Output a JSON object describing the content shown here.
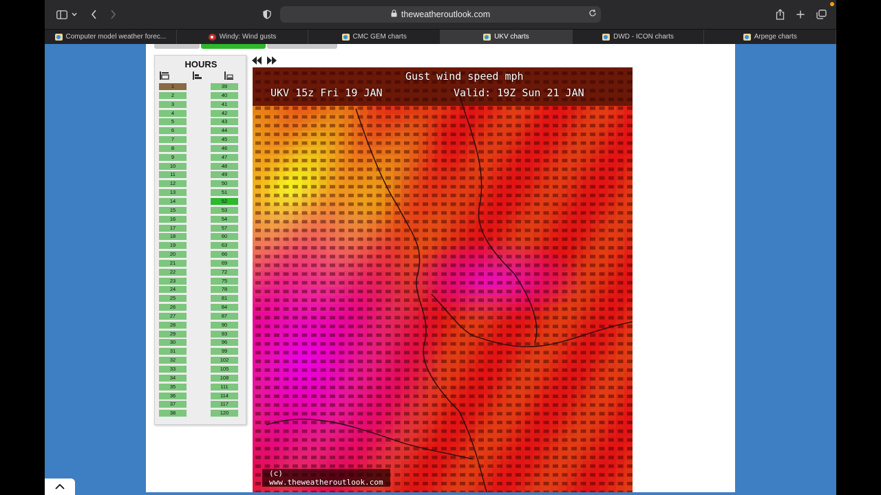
{
  "browser": {
    "url": "theweatheroutlook.com",
    "tabs": [
      {
        "label": "Computer model weather forec...",
        "icon": "two-logo-icon",
        "active": false
      },
      {
        "label": "Windy: Wind gusts",
        "icon": "windy-logo-icon",
        "active": false
      },
      {
        "label": "CMC GEM charts",
        "icon": "two-logo-icon",
        "active": false
      },
      {
        "label": "UKV charts",
        "icon": "two-logo-icon",
        "active": true
      },
      {
        "label": "DWD - ICON charts",
        "icon": "two-logo-icon",
        "active": false
      },
      {
        "label": "Arpege charts",
        "icon": "two-logo-icon",
        "active": false
      }
    ]
  },
  "hours_panel": {
    "title": "HOURS",
    "left_column": [
      "1",
      "2",
      "3",
      "4",
      "5",
      "6",
      "7",
      "8",
      "9",
      "10",
      "11",
      "12",
      "13",
      "14",
      "15",
      "16",
      "17",
      "18",
      "19",
      "20",
      "21",
      "22",
      "23",
      "24",
      "25",
      "26",
      "27",
      "28",
      "29",
      "30",
      "31",
      "32",
      "33",
      "34",
      "35",
      "36",
      "37",
      "38"
    ],
    "right_column": [
      "39",
      "40",
      "41",
      "42",
      "43",
      "44",
      "45",
      "46",
      "47",
      "48",
      "49",
      "50",
      "51",
      "52",
      "53",
      "54",
      "57",
      "60",
      "63",
      "66",
      "69",
      "72",
      "75",
      "78",
      "81",
      "84",
      "87",
      "90",
      "93",
      "96",
      "99",
      "102",
      "105",
      "108",
      "111",
      "114",
      "117",
      "120"
    ],
    "selected_left": "1",
    "selected_right": "52"
  },
  "chart": {
    "title": "Gust wind speed mph",
    "run": "UKV 15z Fri 19 JAN",
    "valid": "Valid: 19Z Sun 21 JAN",
    "copyright": "(c) www.theweatheroutlook.com"
  },
  "colors": {
    "page_bg": "#3d7fc2",
    "hour_cell": "#7dc67e",
    "hour_selected_left": "#8b6b43",
    "hour_selected_right": "#2db82d"
  }
}
